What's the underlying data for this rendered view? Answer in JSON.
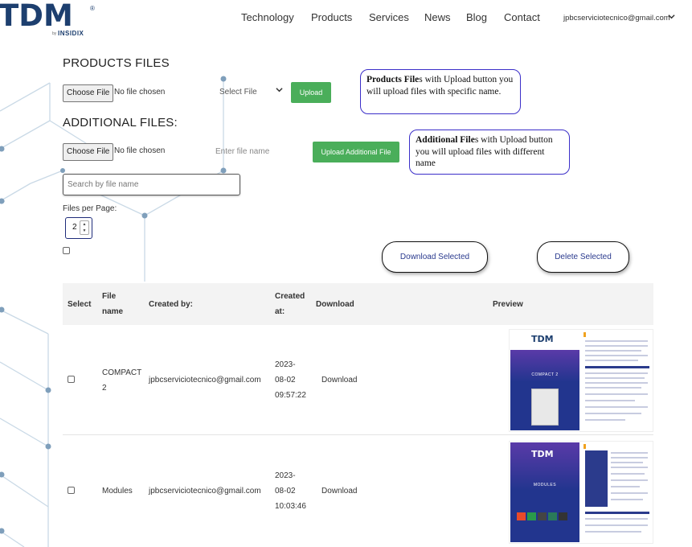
{
  "header": {
    "logo_text": "TDM",
    "logo_reg": "®",
    "logo_by": "by",
    "logo_sub": "INSIDIX",
    "nav": [
      "Technology",
      "Products",
      "Services",
      "News",
      "Blog",
      "Contact"
    ],
    "user_email": "jpbcserviciotecnico@gmail.com",
    "user_menu_icon": "chevron-down-icon"
  },
  "products_files": {
    "title": "PRODUCTS FILES",
    "choose_label": "Choose File",
    "no_file_text": "No file chosen",
    "select_placeholder": "Select File",
    "upload_label": "Upload"
  },
  "additional_files": {
    "title": "ADDITIONAL FILES:",
    "choose_label": "Choose File",
    "no_file_text": "No file chosen",
    "name_placeholder": "Enter file name",
    "upload_label": "Upload Additional File"
  },
  "callouts": {
    "products": {
      "bold": "Products File",
      "text": "s with Upload button you will upload files with specific name."
    },
    "additional": {
      "bold": "Additional File",
      "text": "s with Upload button you will upload files with different name"
    }
  },
  "search": {
    "placeholder": "Search by file name"
  },
  "files_per_page": {
    "label": "Files per Page:",
    "value": "2"
  },
  "actions": {
    "download_selected": "Download Selected",
    "delete_selected": "Delete Selected"
  },
  "table": {
    "columns": {
      "select": "Select",
      "file_name_1": "File",
      "file_name_2": "name",
      "created_by": "Created by:",
      "created_at_1": "Created",
      "created_at_2": "at:",
      "download": "Download",
      "preview": "Preview"
    },
    "rows": [
      {
        "name_1": "COMPACT",
        "name_2": "2",
        "created_by": "jpbcserviciotecnico@gmail.com",
        "date": "2023-",
        "date_2": "08-02",
        "time": "09:57:22",
        "download": "Download",
        "preview": {
          "logo": "TDM",
          "title": "COMPACT 2"
        }
      },
      {
        "name_1": "Modules",
        "name_2": "",
        "created_by": "jpbcserviciotecnico@gmail.com",
        "date": "2023-",
        "date_2": "08-02",
        "time": "10:03:46",
        "download": "Download",
        "preview": {
          "logo": "TDM",
          "title": "MODULES"
        }
      }
    ]
  },
  "colors": {
    "brand": "#1d3f6f",
    "upload_green": "#4aae5a",
    "callout_border": "#3b2fc9",
    "action_text": "#2a3a8e"
  }
}
